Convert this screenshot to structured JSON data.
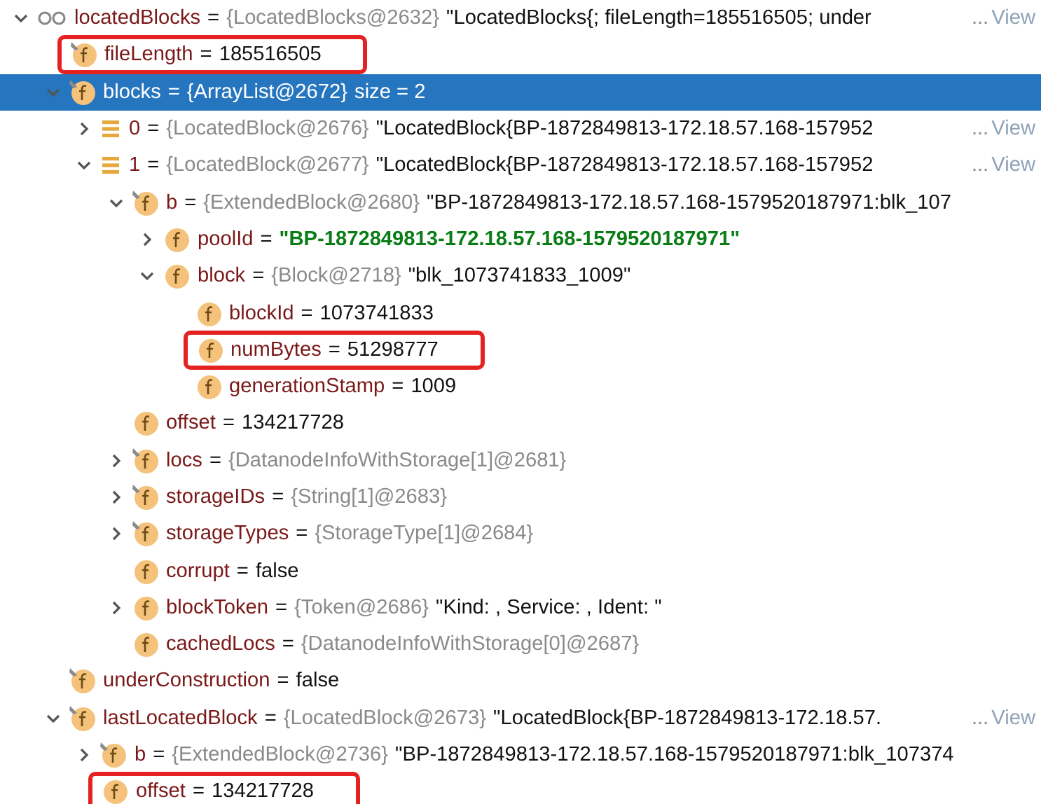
{
  "tree": [
    {
      "kind": "watch",
      "expanded": true,
      "name": "locatedBlocks",
      "equals": "=",
      "type": "{LocatedBlocks@2632}",
      "value": "\"LocatedBlocks{;  fileLength=185516505;  under",
      "more": "...",
      "link": "View",
      "literal": false,
      "selected": false,
      "highlighted": false,
      "children": [
        {
          "kind": "pinned-field",
          "name": "fileLength",
          "equals": "=",
          "value": "185516505",
          "literal": false,
          "selected": false,
          "highlighted": true
        },
        {
          "kind": "pinned-field",
          "expanded": true,
          "name": "blocks",
          "equals": "=",
          "type": "{ArrayList@2672}",
          "value": "size = 2",
          "literal": false,
          "selected": true,
          "highlighted": false,
          "children": [
            {
              "kind": "element",
              "expanded": false,
              "name": "0",
              "equals": "=",
              "type": "{LocatedBlock@2676}",
              "value": "\"LocatedBlock{BP-1872849813-172.18.57.168-157952",
              "more": "...",
              "link": "View",
              "literal": false,
              "selected": false,
              "highlighted": false
            },
            {
              "kind": "element",
              "expanded": true,
              "name": "1",
              "equals": "=",
              "type": "{LocatedBlock@2677}",
              "value": "\"LocatedBlock{BP-1872849813-172.18.57.168-157952",
              "more": "...",
              "link": "View",
              "literal": false,
              "selected": false,
              "highlighted": false,
              "children": [
                {
                  "kind": "pinned-field",
                  "expanded": true,
                  "name": "b",
                  "equals": "=",
                  "type": "{ExtendedBlock@2680}",
                  "value": "\"BP-1872849813-172.18.57.168-1579520187971:blk_107",
                  "literal": false,
                  "selected": false,
                  "highlighted": false,
                  "children": [
                    {
                      "kind": "field",
                      "expanded": false,
                      "name": "poolId",
                      "equals": "=",
                      "value": "\"BP-1872849813-172.18.57.168-1579520187971\"",
                      "literal": true,
                      "selected": false,
                      "highlighted": false
                    },
                    {
                      "kind": "field",
                      "expanded": true,
                      "name": "block",
                      "equals": "=",
                      "type": "{Block@2718}",
                      "value": "\"blk_1073741833_1009\"",
                      "literal": false,
                      "selected": false,
                      "highlighted": false,
                      "children": [
                        {
                          "kind": "field",
                          "name": "blockId",
                          "equals": "=",
                          "value": "1073741833",
                          "literal": false,
                          "selected": false,
                          "highlighted": false
                        },
                        {
                          "kind": "field",
                          "name": "numBytes",
                          "equals": "=",
                          "value": "51298777",
                          "literal": false,
                          "selected": false,
                          "highlighted": true
                        },
                        {
                          "kind": "field",
                          "name": "generationStamp",
                          "equals": "=",
                          "value": "1009",
                          "literal": false,
                          "selected": false,
                          "highlighted": false
                        }
                      ]
                    }
                  ]
                },
                {
                  "kind": "field",
                  "name": "offset",
                  "equals": "=",
                  "value": "134217728",
                  "literal": false,
                  "selected": false,
                  "highlighted": false
                },
                {
                  "kind": "pinned-field",
                  "expanded": false,
                  "name": "locs",
                  "equals": "=",
                  "type": "{DatanodeInfoWithStorage[1]@2681}",
                  "selected": false,
                  "highlighted": false
                },
                {
                  "kind": "pinned-field",
                  "expanded": false,
                  "name": "storageIDs",
                  "equals": "=",
                  "type": "{String[1]@2683}",
                  "selected": false,
                  "highlighted": false
                },
                {
                  "kind": "pinned-field",
                  "expanded": false,
                  "name": "storageTypes",
                  "equals": "=",
                  "type": "{StorageType[1]@2684}",
                  "selected": false,
                  "highlighted": false
                },
                {
                  "kind": "field",
                  "name": "corrupt",
                  "equals": "=",
                  "value": "false",
                  "literal": false,
                  "selected": false,
                  "highlighted": false
                },
                {
                  "kind": "field",
                  "expanded": false,
                  "name": "blockToken",
                  "equals": "=",
                  "type": "{Token@2686}",
                  "value": "\"Kind: , Service: , Ident: \"",
                  "literal": false,
                  "selected": false,
                  "highlighted": false
                },
                {
                  "kind": "field",
                  "name": "cachedLocs",
                  "equals": "=",
                  "type": "{DatanodeInfoWithStorage[0]@2687}",
                  "selected": false,
                  "highlighted": false
                }
              ]
            }
          ]
        },
        {
          "kind": "pinned-field",
          "name": "underConstruction",
          "equals": "=",
          "value": "false",
          "literal": false,
          "selected": false,
          "highlighted": false
        },
        {
          "kind": "pinned-field",
          "expanded": true,
          "name": "lastLocatedBlock",
          "equals": "=",
          "type": "{LocatedBlock@2673}",
          "value": "\"LocatedBlock{BP-1872849813-172.18.57.",
          "more": "...",
          "link": "View",
          "literal": false,
          "selected": false,
          "highlighted": false,
          "children": [
            {
              "kind": "pinned-field",
              "expanded": false,
              "name": "b",
              "equals": "=",
              "type": "{ExtendedBlock@2736}",
              "value": "\"BP-1872849813-172.18.57.168-1579520187971:blk_107374",
              "literal": false,
              "selected": false,
              "highlighted": false
            },
            {
              "kind": "field",
              "name": "offset",
              "equals": "=",
              "value": "134217728",
              "literal": false,
              "selected": false,
              "highlighted": true
            }
          ]
        }
      ]
    }
  ]
}
